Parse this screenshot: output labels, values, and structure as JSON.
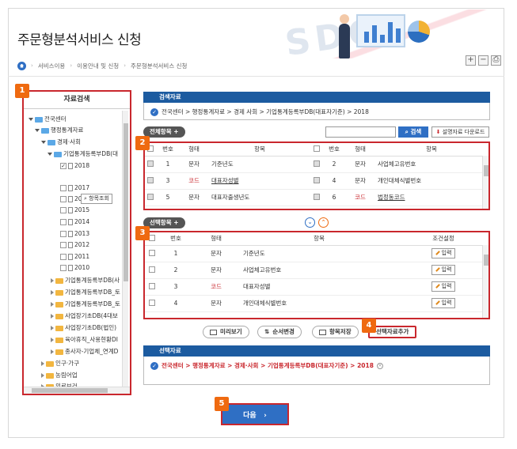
{
  "header": {
    "title": "주문형분석서비스 신청",
    "breadcrumb": [
      "서비스이용",
      "이용안내 및 신청",
      "주문형분석서비스 신청"
    ],
    "tools": [
      "+",
      "−",
      "⎙"
    ]
  },
  "tree": {
    "title": "자료검색",
    "search_item_label": "항목조회",
    "items": [
      "전국센터",
      "행정통계자료",
      "경제·사회",
      "기업통계등록부DB(대",
      "2018",
      "2017",
      "2016",
      "2015",
      "2014",
      "2013",
      "2012",
      "2011",
      "2010",
      "기업통계등록부DB(사",
      "기업통계등록부DB_토",
      "기업통계등록부DB_토",
      "사업장기초DB(4대보",
      "사업장기초DB(법인)",
      "육아휴직_사용현황DI",
      "종사자-기업체_연계D",
      "인구·가구",
      "농림어업",
      "의료보건"
    ]
  },
  "search_data": {
    "title": "검색자료",
    "path": "전국센터 > 행정통계자료 > 경제 사회 > 기업통계등록부DB(대표자기준) > 2018"
  },
  "all_items": {
    "label": "전체항목",
    "plus": "+",
    "search_button": "검색",
    "download_button": "설명자료 다운로드",
    "headers": [
      "번호",
      "형태",
      "항목",
      "번호",
      "형태",
      "항목"
    ],
    "rows": [
      {
        "n1": "1",
        "t1": "문자",
        "i1": "기준년도",
        "n2": "2",
        "t2": "문자",
        "i2": "사업체고유번호"
      },
      {
        "n1": "3",
        "t1": "코드",
        "i1": "대표자성별",
        "n2": "4",
        "t2": "문자",
        "i2": "개인대체식별번호"
      },
      {
        "n1": "5",
        "t1": "문자",
        "i1": "대표자출생년도",
        "n2": "6",
        "t2": "코드",
        "i2": "법정동코드"
      }
    ]
  },
  "selected_items": {
    "label": "선택항목",
    "plus": "+",
    "down_arrow": "⌄",
    "up_arrow": "⌃",
    "headers": [
      "번호",
      "형태",
      "항목",
      "조건설정"
    ],
    "input_label": "입력",
    "rows": [
      {
        "n": "1",
        "t": "문자",
        "i": "기준년도"
      },
      {
        "n": "2",
        "t": "문자",
        "i": "사업체고유번호"
      },
      {
        "n": "3",
        "t": "코드",
        "i": "대표자성별"
      },
      {
        "n": "4",
        "t": "문자",
        "i": "개인대체식별번호"
      }
    ]
  },
  "actions": {
    "preview": "미리보기",
    "reorder": "순서변경",
    "save": "항목저장",
    "add_selected": "선택자료추가"
  },
  "selected_data": {
    "title": "선택자료",
    "path": "전국센터 > 행정통계자료 > 경제·사회 > 기업통계등록부DB(대표자기준) > 2018",
    "remove": "×"
  },
  "next_button": "다음",
  "next_arrow": "›",
  "badges": [
    "1",
    "2",
    "3",
    "4",
    "5"
  ],
  "colors": {
    "accent": "#2f6fc4",
    "header_bar": "#1c5ba0",
    "highlight": "#c9272d",
    "badge": "#ef6a10"
  }
}
